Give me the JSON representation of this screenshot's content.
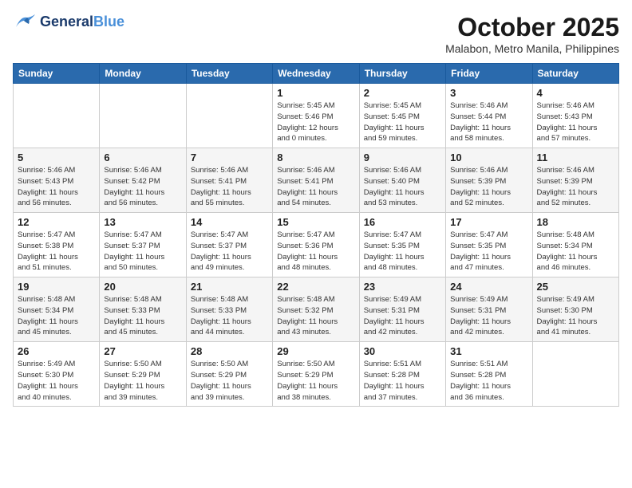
{
  "logo": {
    "line1": "General",
    "line2": "Blue"
  },
  "title": "October 2025",
  "location": "Malabon, Metro Manila, Philippines",
  "days_header": [
    "Sunday",
    "Monday",
    "Tuesday",
    "Wednesday",
    "Thursday",
    "Friday",
    "Saturday"
  ],
  "weeks": [
    [
      {
        "day": "",
        "info": ""
      },
      {
        "day": "",
        "info": ""
      },
      {
        "day": "",
        "info": ""
      },
      {
        "day": "1",
        "info": "Sunrise: 5:45 AM\nSunset: 5:46 PM\nDaylight: 12 hours\nand 0 minutes."
      },
      {
        "day": "2",
        "info": "Sunrise: 5:45 AM\nSunset: 5:45 PM\nDaylight: 11 hours\nand 59 minutes."
      },
      {
        "day": "3",
        "info": "Sunrise: 5:46 AM\nSunset: 5:44 PM\nDaylight: 11 hours\nand 58 minutes."
      },
      {
        "day": "4",
        "info": "Sunrise: 5:46 AM\nSunset: 5:43 PM\nDaylight: 11 hours\nand 57 minutes."
      }
    ],
    [
      {
        "day": "5",
        "info": "Sunrise: 5:46 AM\nSunset: 5:43 PM\nDaylight: 11 hours\nand 56 minutes."
      },
      {
        "day": "6",
        "info": "Sunrise: 5:46 AM\nSunset: 5:42 PM\nDaylight: 11 hours\nand 56 minutes."
      },
      {
        "day": "7",
        "info": "Sunrise: 5:46 AM\nSunset: 5:41 PM\nDaylight: 11 hours\nand 55 minutes."
      },
      {
        "day": "8",
        "info": "Sunrise: 5:46 AM\nSunset: 5:41 PM\nDaylight: 11 hours\nand 54 minutes."
      },
      {
        "day": "9",
        "info": "Sunrise: 5:46 AM\nSunset: 5:40 PM\nDaylight: 11 hours\nand 53 minutes."
      },
      {
        "day": "10",
        "info": "Sunrise: 5:46 AM\nSunset: 5:39 PM\nDaylight: 11 hours\nand 52 minutes."
      },
      {
        "day": "11",
        "info": "Sunrise: 5:46 AM\nSunset: 5:39 PM\nDaylight: 11 hours\nand 52 minutes."
      }
    ],
    [
      {
        "day": "12",
        "info": "Sunrise: 5:47 AM\nSunset: 5:38 PM\nDaylight: 11 hours\nand 51 minutes."
      },
      {
        "day": "13",
        "info": "Sunrise: 5:47 AM\nSunset: 5:37 PM\nDaylight: 11 hours\nand 50 minutes."
      },
      {
        "day": "14",
        "info": "Sunrise: 5:47 AM\nSunset: 5:37 PM\nDaylight: 11 hours\nand 49 minutes."
      },
      {
        "day": "15",
        "info": "Sunrise: 5:47 AM\nSunset: 5:36 PM\nDaylight: 11 hours\nand 48 minutes."
      },
      {
        "day": "16",
        "info": "Sunrise: 5:47 AM\nSunset: 5:35 PM\nDaylight: 11 hours\nand 48 minutes."
      },
      {
        "day": "17",
        "info": "Sunrise: 5:47 AM\nSunset: 5:35 PM\nDaylight: 11 hours\nand 47 minutes."
      },
      {
        "day": "18",
        "info": "Sunrise: 5:48 AM\nSunset: 5:34 PM\nDaylight: 11 hours\nand 46 minutes."
      }
    ],
    [
      {
        "day": "19",
        "info": "Sunrise: 5:48 AM\nSunset: 5:34 PM\nDaylight: 11 hours\nand 45 minutes."
      },
      {
        "day": "20",
        "info": "Sunrise: 5:48 AM\nSunset: 5:33 PM\nDaylight: 11 hours\nand 45 minutes."
      },
      {
        "day": "21",
        "info": "Sunrise: 5:48 AM\nSunset: 5:33 PM\nDaylight: 11 hours\nand 44 minutes."
      },
      {
        "day": "22",
        "info": "Sunrise: 5:48 AM\nSunset: 5:32 PM\nDaylight: 11 hours\nand 43 minutes."
      },
      {
        "day": "23",
        "info": "Sunrise: 5:49 AM\nSunset: 5:31 PM\nDaylight: 11 hours\nand 42 minutes."
      },
      {
        "day": "24",
        "info": "Sunrise: 5:49 AM\nSunset: 5:31 PM\nDaylight: 11 hours\nand 42 minutes."
      },
      {
        "day": "25",
        "info": "Sunrise: 5:49 AM\nSunset: 5:30 PM\nDaylight: 11 hours\nand 41 minutes."
      }
    ],
    [
      {
        "day": "26",
        "info": "Sunrise: 5:49 AM\nSunset: 5:30 PM\nDaylight: 11 hours\nand 40 minutes."
      },
      {
        "day": "27",
        "info": "Sunrise: 5:50 AM\nSunset: 5:29 PM\nDaylight: 11 hours\nand 39 minutes."
      },
      {
        "day": "28",
        "info": "Sunrise: 5:50 AM\nSunset: 5:29 PM\nDaylight: 11 hours\nand 39 minutes."
      },
      {
        "day": "29",
        "info": "Sunrise: 5:50 AM\nSunset: 5:29 PM\nDaylight: 11 hours\nand 38 minutes."
      },
      {
        "day": "30",
        "info": "Sunrise: 5:51 AM\nSunset: 5:28 PM\nDaylight: 11 hours\nand 37 minutes."
      },
      {
        "day": "31",
        "info": "Sunrise: 5:51 AM\nSunset: 5:28 PM\nDaylight: 11 hours\nand 36 minutes."
      },
      {
        "day": "",
        "info": ""
      }
    ]
  ]
}
